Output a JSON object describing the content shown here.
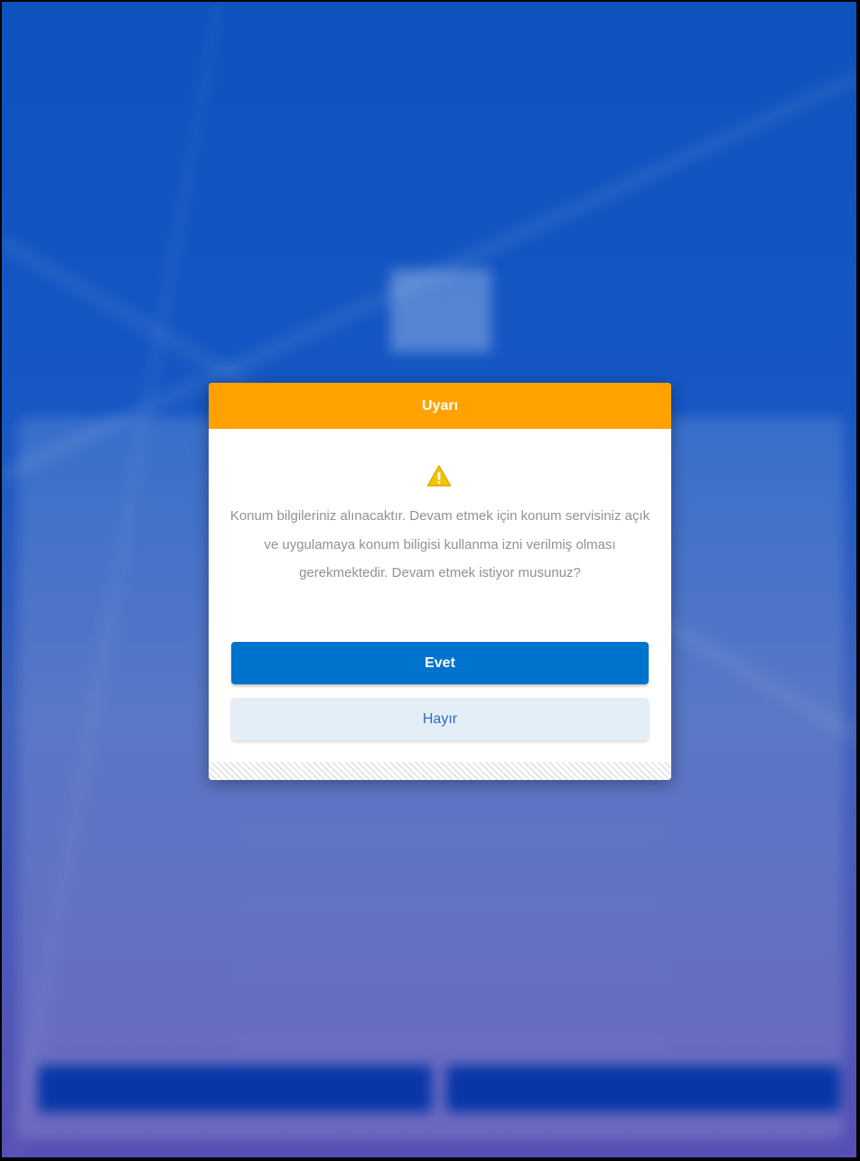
{
  "dialog": {
    "title": "Uyarı",
    "message": "Konum bilgileriniz alınacaktır. Devam etmek için konum servisiniz açık ve uygulamaya konum biligisi kullanma izni verilmiş olması gerekmektedir. Devam etmek istiyor musunuz?",
    "yes_label": "Evet",
    "no_label": "Hayır"
  },
  "colors": {
    "header": "#ffa200",
    "primary_button": "#0073cc",
    "secondary_button": "#e4eef7",
    "warning_icon": "#f5c400"
  },
  "icons": {
    "warning": "warning-triangle-icon"
  }
}
